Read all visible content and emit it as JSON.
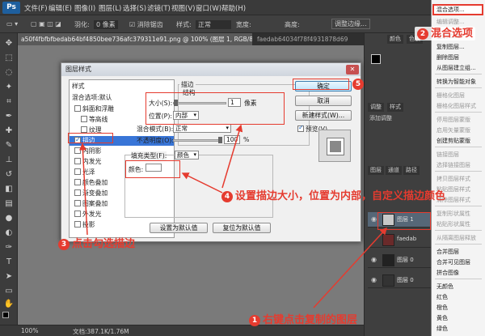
{
  "app": {
    "logo": "Ps"
  },
  "menu": [
    "文件(F)",
    "编辑(E)",
    "图像(I)",
    "图层(L)",
    "选择(S)",
    "滤镜(T)",
    "视图(V)",
    "窗口(W)",
    "帮助(H)"
  ],
  "options": {
    "feather": "羽化:",
    "feather_value": "0 像素",
    "antialias": "消除锯齿",
    "style": "样式:",
    "style_value": "正常",
    "width": "宽度:",
    "height": "高度:",
    "refine": "调整边缘..."
  },
  "tabs": [
    {
      "label": "a50f4fbfbfbedab64bf4850bee736afc379311e91.png @ 100% (图层 1, RGB/8#) *"
    },
    {
      "label": "faedab64034f78f4931878d69"
    }
  ],
  "status": {
    "zoom": "100%",
    "doc": "文档:387.1K/1.76M"
  },
  "dialog": {
    "title": "图层样式",
    "styles_header": "样式",
    "blend_default": "混合选项:默认",
    "styles": [
      {
        "label": "斜面和浮雕",
        "checked": false,
        "indent": false
      },
      {
        "label": "等高线",
        "checked": false,
        "indent": true
      },
      {
        "label": "纹理",
        "checked": false,
        "indent": true
      },
      {
        "label": "描边",
        "checked": true,
        "indent": false,
        "selected": true
      },
      {
        "label": "内阴影",
        "checked": false,
        "indent": false
      },
      {
        "label": "内发光",
        "checked": false,
        "indent": false
      },
      {
        "label": "光泽",
        "checked": false,
        "indent": false
      },
      {
        "label": "颜色叠加",
        "checked": false,
        "indent": false
      },
      {
        "label": "渐变叠加",
        "checked": false,
        "indent": false
      },
      {
        "label": "图案叠加",
        "checked": false,
        "indent": false
      },
      {
        "label": "外发光",
        "checked": false,
        "indent": false
      },
      {
        "label": "投影",
        "checked": false,
        "indent": false
      }
    ],
    "stroke": {
      "section": "描边",
      "structure": "结构",
      "size_label": "大小(S):",
      "size_value": "1",
      "size_unit": "像素",
      "position_label": "位置(P):",
      "position_value": "内部",
      "blend_label": "混合模式(B):",
      "blend_value": "正常",
      "opacity_label": "不透明度(O):",
      "opacity_value": "100",
      "opacity_unit": "%",
      "fill_label": "填充类型(F):",
      "fill_value": "颜色",
      "color_label": "颜色:",
      "color": "#ffffff"
    },
    "buttons": {
      "ok": "确定",
      "cancel": "取消",
      "new_style": "新建样式(W)...",
      "preview": "预览(V)",
      "set_default": "设置为默认值",
      "reset_default": "复位为默认值"
    }
  },
  "right_panel": {
    "panel_tabs_top": [
      "颜色",
      "色板"
    ],
    "panel_tabs_mid": [
      "调整",
      "样式"
    ],
    "add_adjust": "添加调整",
    "layer_tabs": [
      "图层",
      "通道",
      "路径"
    ],
    "layers": [
      {
        "name": "图层 1",
        "thumb": "#c8c8c8"
      },
      {
        "name": "faedab",
        "thumb": "#6a2a2a"
      },
      {
        "name": "图层 0",
        "thumb": "#222222"
      },
      {
        "name": "图层 0",
        "thumb": "#333333"
      }
    ]
  },
  "context_menu": {
    "items": [
      {
        "label": "混合选项...",
        "state": "highlight"
      },
      {
        "label": "编辑调整...",
        "state": "disabled"
      },
      {
        "label": "复制 CSS",
        "state": "normal"
      },
      {
        "label": "复制图层...",
        "state": "normal"
      },
      {
        "label": "删除图层",
        "state": "normal"
      },
      {
        "label": "从图层建立组...",
        "state": "normal"
      },
      {
        "label": "转换为智能对象",
        "state": "normal"
      },
      {
        "label": "栅格化图层",
        "state": "disabled"
      },
      {
        "label": "栅格化图层样式",
        "state": "disabled"
      },
      {
        "label": "停用图层蒙版",
        "state": "disabled"
      },
      {
        "label": "启用矢量蒙版",
        "state": "disabled"
      },
      {
        "label": "创建剪贴蒙版",
        "state": "normal"
      },
      {
        "label": "链接图层",
        "state": "disabled"
      },
      {
        "label": "选择链接图层",
        "state": "disabled"
      },
      {
        "label": "拷贝图层样式",
        "state": "disabled"
      },
      {
        "label": "粘贴图层样式",
        "state": "disabled"
      },
      {
        "label": "清除图层样式",
        "state": "disabled"
      },
      {
        "label": "复制形状属性",
        "state": "disabled"
      },
      {
        "label": "粘贴形状属性",
        "state": "disabled"
      },
      {
        "label": "从隔离图层释放",
        "state": "disabled"
      },
      {
        "label": "合并图层",
        "state": "normal"
      },
      {
        "label": "合并可见图层",
        "state": "normal"
      },
      {
        "label": "拼合图像",
        "state": "normal"
      },
      {
        "label": "无颜色",
        "state": "normal"
      },
      {
        "label": "红色",
        "state": "normal"
      },
      {
        "label": "橙色",
        "state": "normal"
      },
      {
        "label": "黄色",
        "state": "normal"
      },
      {
        "label": "绿色",
        "state": "normal"
      }
    ]
  },
  "annotations": {
    "a1": {
      "num": "1",
      "text": "右键点击复制的图层"
    },
    "a2": {
      "num": "2",
      "text": "混合选项"
    },
    "a3": {
      "num": "3",
      "text": "点击勾选描边"
    },
    "a4": {
      "num": "4",
      "text": "设置描边大小，位置为内部，自定义描边颜色"
    },
    "a5": {
      "num": "5",
      "text": ""
    }
  },
  "colors": {
    "accent_red": "#e53b2f",
    "selection_blue": "#3875d7",
    "ps_blue": "#1e5f9e"
  },
  "icons": [
    "move-icon",
    "marquee-icon",
    "lasso-icon",
    "magic-wand-icon",
    "crop-icon",
    "eyedropper-icon",
    "healing-icon",
    "brush-icon",
    "stamp-icon",
    "history-brush-icon",
    "eraser-icon",
    "gradient-icon",
    "blur-icon",
    "dodge-icon",
    "pen-icon",
    "type-icon",
    "path-select-icon",
    "shape-icon",
    "hand-icon",
    "zoom-icon"
  ]
}
